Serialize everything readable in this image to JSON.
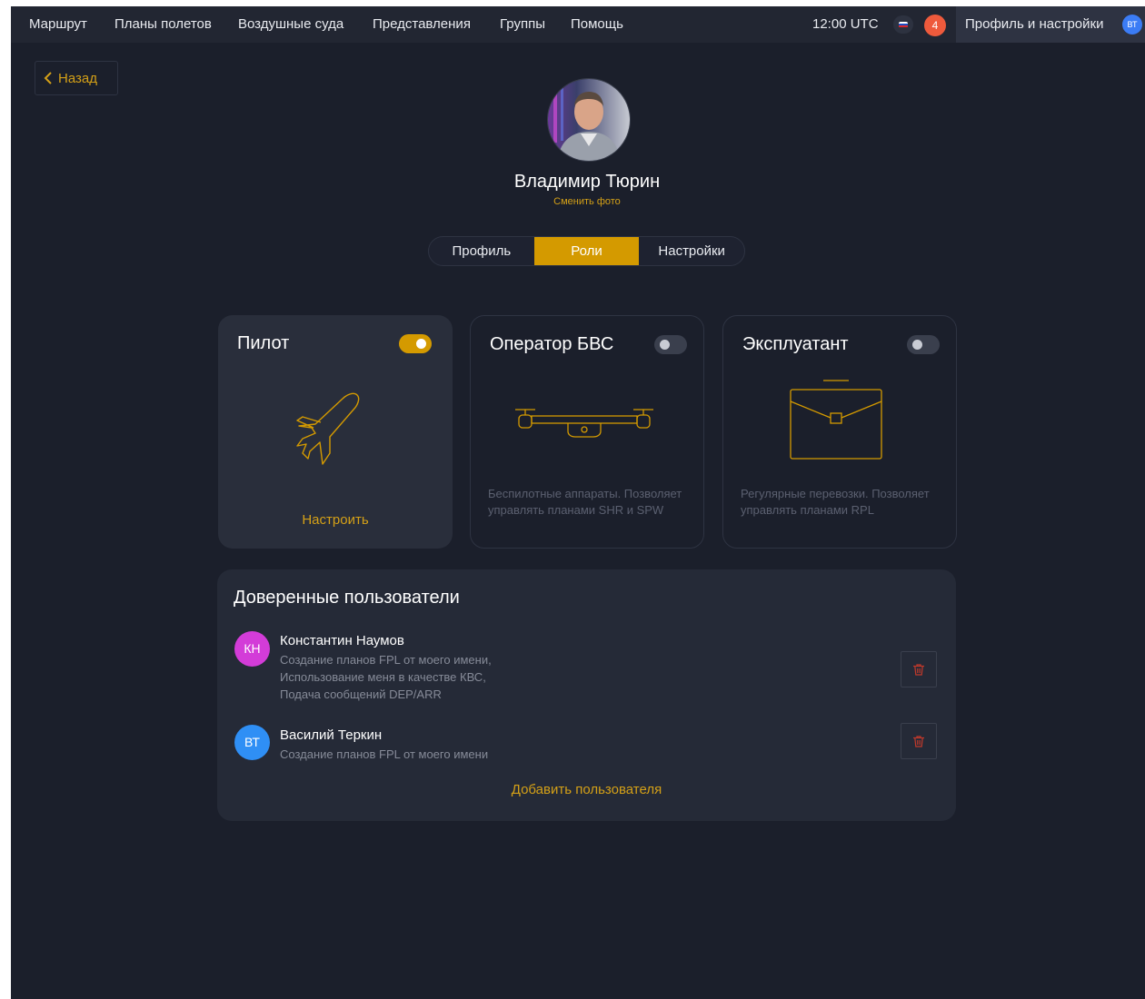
{
  "nav": {
    "items": [
      "Маршрут",
      "Планы полетов",
      "Воздушные суда",
      "Представления",
      "Группы",
      "Помощь"
    ],
    "time": "12:00 UTC",
    "notifications": "4",
    "profile_label": "Профиль и настройки",
    "profile_initials": "ВТ"
  },
  "back_label": "Назад",
  "profile": {
    "name": "Владимир Тюрин",
    "change_photo": "Сменить фото"
  },
  "tabs": [
    "Профиль",
    "Роли",
    "Настройки"
  ],
  "active_tab": "Роли",
  "roles": [
    {
      "title": "Пилот",
      "enabled": true,
      "icon": "airplane-icon",
      "action": "Настроить",
      "description": ""
    },
    {
      "title": "Оператор БВС",
      "enabled": false,
      "icon": "drone-icon",
      "action": "",
      "description": "Беспилотные аппараты. Позволяет управлять планами SHR и SPW"
    },
    {
      "title": "Эксплуатант",
      "enabled": false,
      "icon": "briefcase-icon",
      "action": "",
      "description": "Регулярные перевозки. Позволяет управлять планами RPL"
    }
  ],
  "trusted": {
    "title": "Доверенные пользователи",
    "users": [
      {
        "initials": "КН",
        "name": "Константин Наумов",
        "color": "#d33cd8",
        "permissions": [
          "Создание планов FPL от моего имени,",
          "Использование меня в качестве КВС,",
          "Подача сообщений DEP/ARR"
        ]
      },
      {
        "initials": "ВТ",
        "name": "Василий Теркин",
        "color": "#2f8ff5",
        "permissions": [
          "Создание планов FPL от моего имени"
        ]
      }
    ],
    "add_label": "Добавить пользователя"
  },
  "colors": {
    "accent": "#d49a00",
    "background": "#1b1f2b",
    "delete": "#c0392b"
  }
}
